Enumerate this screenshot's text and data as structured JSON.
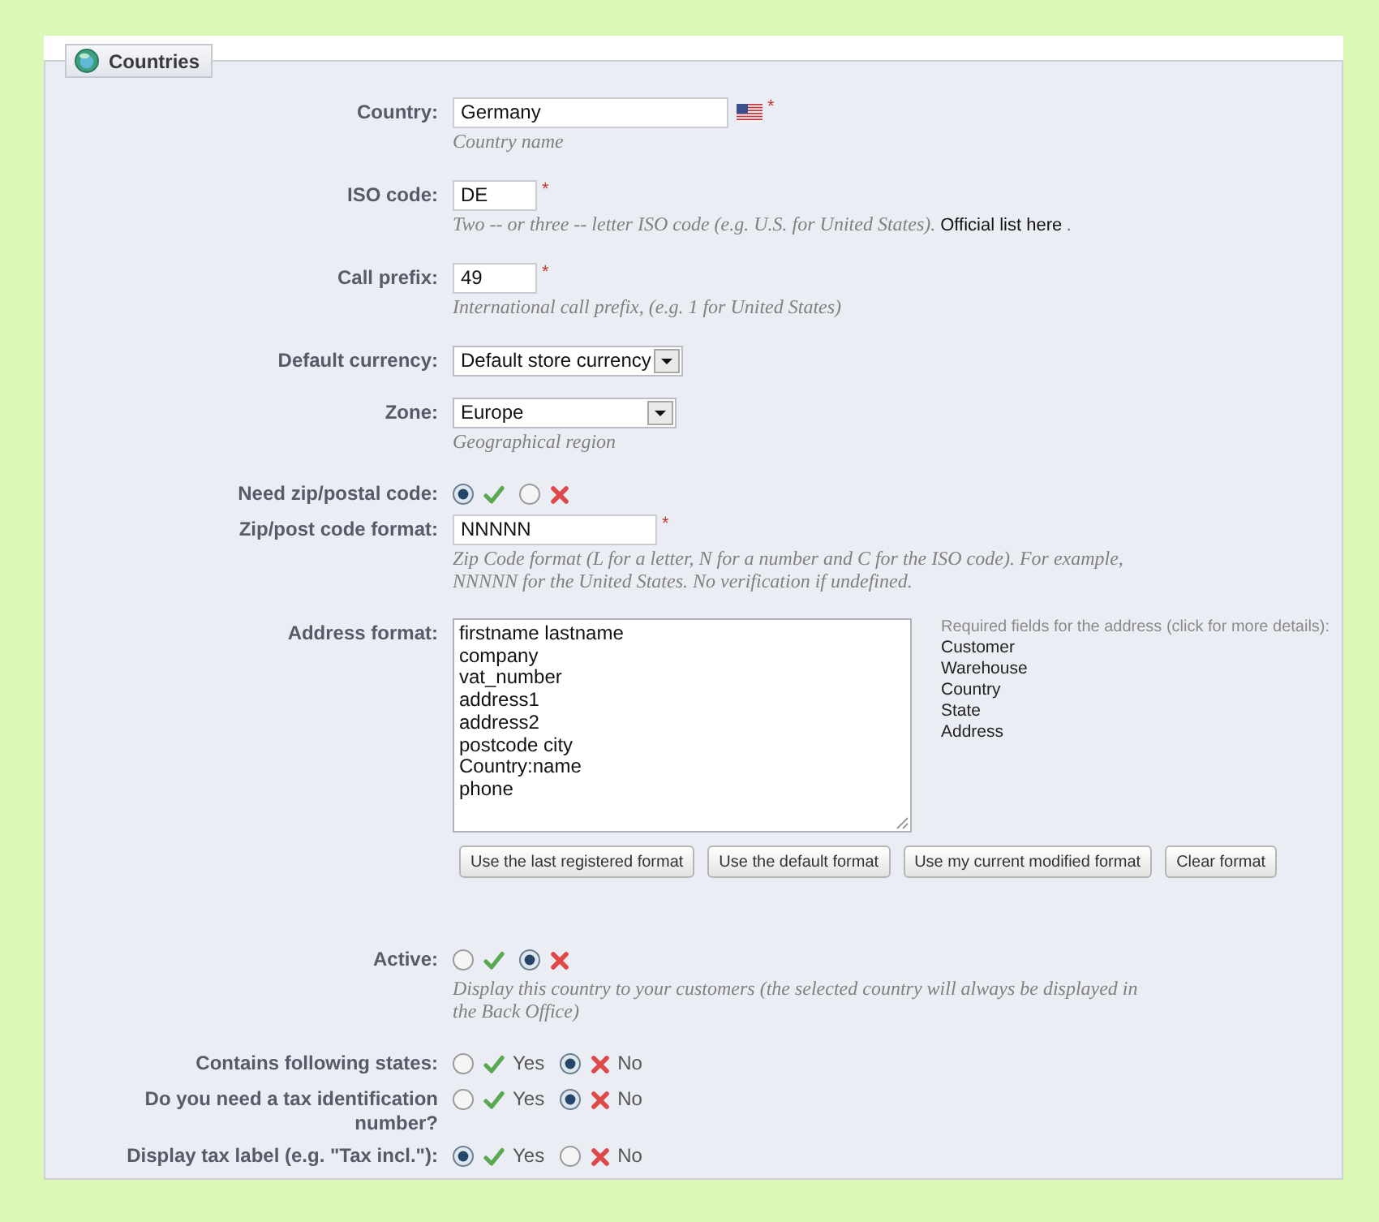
{
  "panel": {
    "title": "Countries"
  },
  "fields": [
    {
      "kind": "text",
      "label": "Country:",
      "value": "Germany",
      "translatable": true,
      "required_mark": "*",
      "hint": "Country name"
    },
    {
      "kind": "text",
      "label": "ISO code:",
      "value": "DE",
      "required_mark": "*",
      "hint": "Two -- or three -- letter ISO code (e.g. U.S. for United States).",
      "hint_link": "Official list here",
      "hint_end": "."
    },
    {
      "kind": "text",
      "label": "Call prefix:",
      "value": "49",
      "required_mark": "*",
      "hint": "International call prefix, (e.g. 1 for United States)"
    },
    {
      "kind": "select",
      "label": "Default currency:",
      "value": "Default store currency"
    },
    {
      "kind": "select",
      "label": "Zone:",
      "value": "Europe",
      "hint": "Geographical region"
    },
    {
      "kind": "switch",
      "label": "Need zip/postal code:",
      "options": [
        {
          "kind": "yes",
          "selected": true
        },
        {
          "kind": "no",
          "selected": false
        }
      ]
    },
    {
      "kind": "text",
      "label": "Zip/post code format:",
      "value": "NNNNN",
      "required_mark": "*",
      "hint": "Zip Code format (L for a letter, N for a number and C for the ISO code). For example, NNNNN for the United States. No verification if undefined."
    },
    {
      "kind": "address",
      "label": "Address format:",
      "value": "firstname lastname\ncompany\nvat_number\naddress1\naddress2\npostcode city\nCountry:name\nphone",
      "required_fields": {
        "title": "Required fields for the address (click for more details):",
        "items": [
          "Customer",
          "Warehouse",
          "Country",
          "State",
          "Address"
        ]
      },
      "buttons": [
        "Use the last registered format",
        "Use the default format",
        "Use my current modified format",
        "Clear format"
      ]
    },
    {
      "kind": "switch",
      "label": "Active:",
      "options": [
        {
          "kind": "yes",
          "selected": false
        },
        {
          "kind": "no",
          "selected": true
        }
      ],
      "hint": "Display this country to your customers (the selected country will always be displayed in the Back Office)"
    },
    {
      "kind": "switch",
      "label": "Contains following states:",
      "options": [
        {
          "kind": "yes",
          "label": "Yes",
          "selected": false
        },
        {
          "kind": "no",
          "label": "No",
          "selected": true
        }
      ]
    },
    {
      "kind": "switch",
      "label": "Do you need a tax identification number?",
      "options": [
        {
          "kind": "yes",
          "label": "Yes",
          "selected": false
        },
        {
          "kind": "no",
          "label": "No",
          "selected": true
        }
      ]
    },
    {
      "kind": "switch",
      "label": "Display tax label (e.g. \"Tax incl.\"):",
      "options": [
        {
          "kind": "yes",
          "label": "Yes",
          "selected": true
        },
        {
          "kind": "no",
          "label": "No",
          "selected": false
        }
      ]
    }
  ]
}
